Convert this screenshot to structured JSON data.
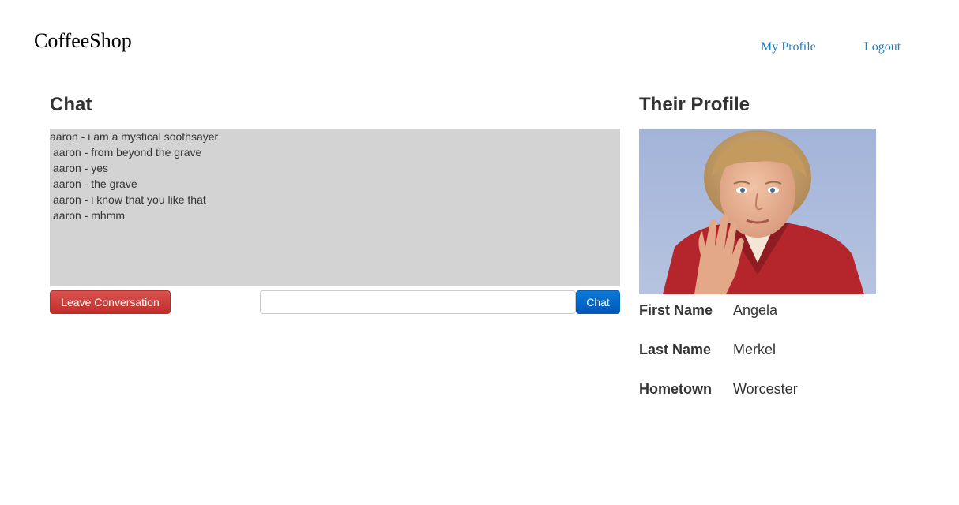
{
  "header": {
    "brand": "CoffeeShop",
    "nav": {
      "my_profile": "My Profile",
      "logout": "Logout"
    }
  },
  "chat": {
    "title": "Chat",
    "messages": [
      "aaron - i am a mystical soothsayer",
      "aaron - from beyond the grave",
      "aaron - yes",
      "aaron - the grave",
      "aaron - i know that you like that",
      "aaron - mhmm"
    ],
    "leave_label": "Leave Conversation",
    "input_value": "",
    "send_label": "Chat"
  },
  "profile": {
    "title": "Their Profile",
    "fields": [
      {
        "label": "First Name",
        "value": "Angela"
      },
      {
        "label": "Last Name",
        "value": "Merkel"
      },
      {
        "label": "Hometown",
        "value": "Worcester"
      }
    ]
  },
  "colors": {
    "link": "#1a7fc1",
    "chat_background": "#d3d3d3",
    "danger": "#d9534f",
    "primary": "#0a7ad8"
  }
}
